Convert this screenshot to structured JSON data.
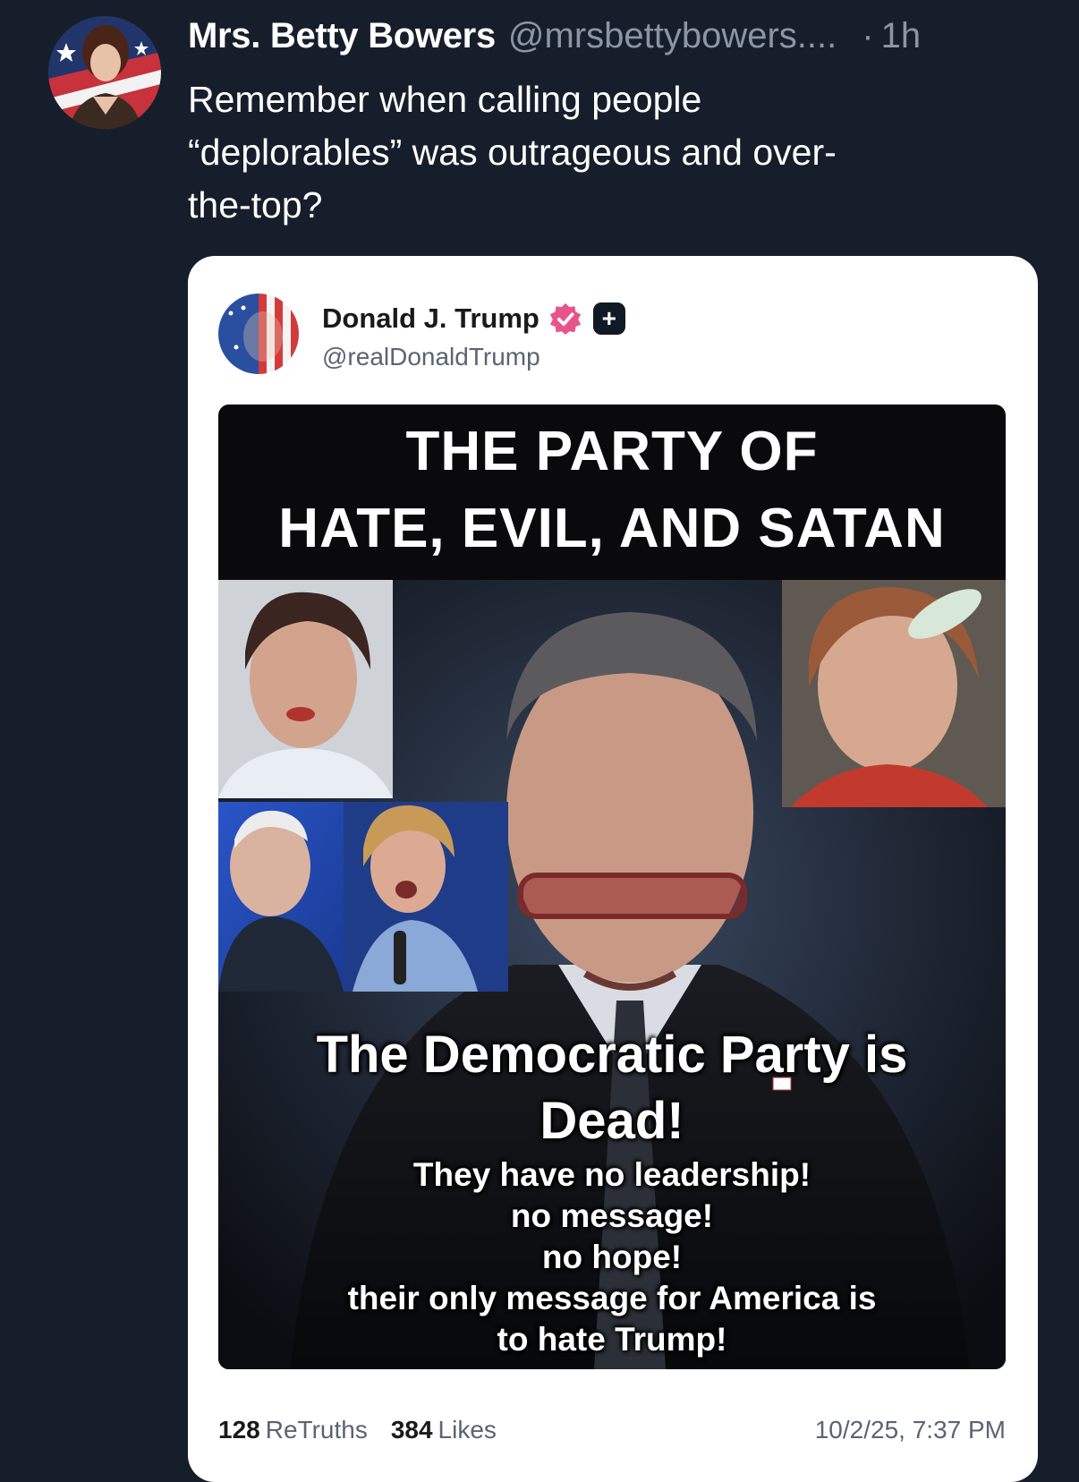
{
  "post": {
    "author_name": "Mrs. Betty Bowers",
    "author_handle": "@mrsbettybowers....",
    "dot": "·",
    "time": "1h",
    "text_lines": [
      "Remember when calling people",
      "“deplorables” was  outrageous and over-",
      "the-top?"
    ]
  },
  "embed": {
    "author_name": "Donald J. Trump",
    "author_handle": "@realDonaldTrump",
    "verified_icon": "verified-badge-icon",
    "plus_icon": "plus-badge-icon",
    "meme": {
      "title_lines": [
        "THE PARTY OF",
        "HATE, EVIL, AND SATAN"
      ],
      "caption_main_lines": [
        "The Democratic Party is",
        "Dead!"
      ],
      "caption_sub_lines": [
        "They have no leadership!",
        "no message!",
        "no hope!",
        "their only message for America is",
        "to hate Trump!"
      ]
    },
    "stats": {
      "retruths_count": "128",
      "retruths_label": "ReTruths",
      "likes_count": "384",
      "likes_label": "Likes"
    },
    "date": "10/2/25, 7:37 PM"
  },
  "colors": {
    "background": "#161e2b",
    "card": "#ffffff",
    "muted_text": "#8a95a6",
    "verified_pink": "#e8548a"
  }
}
